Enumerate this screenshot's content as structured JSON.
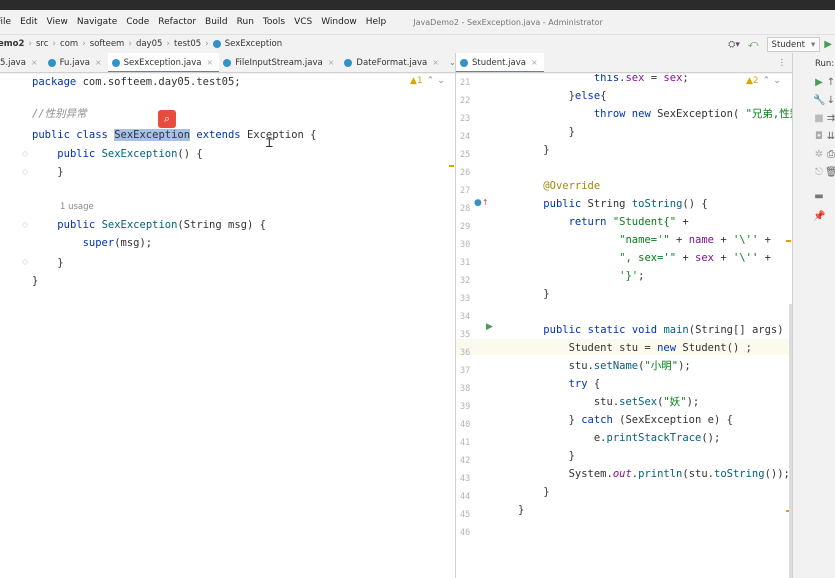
{
  "menu": {
    "items": [
      "File",
      "Edit",
      "View",
      "Navigate",
      "Code",
      "Refactor",
      "Build",
      "Run",
      "Tools",
      "VCS",
      "Window",
      "Help"
    ],
    "window_title": "JavaDemo2 - SexException.java - Administrator"
  },
  "breadcrumb": [
    "emo2",
    "src",
    "com",
    "softeem",
    "day05",
    "test05",
    "SexException"
  ],
  "run_config": "Student",
  "run_panel_label": "Run:",
  "left_tabs": [
    {
      "label": "5.java",
      "active": false
    },
    {
      "label": "Fu.java",
      "active": false
    },
    {
      "label": "SexException.java",
      "active": true
    },
    {
      "label": "FileInputStream.java",
      "active": false
    },
    {
      "label": "DateFormat.java",
      "active": false
    }
  ],
  "right_tabs": [
    {
      "label": "Student.java",
      "active": true
    }
  ],
  "left_editor": {
    "warning_count": "1",
    "usage_hint": "1 usage",
    "lines": [
      "package com.softeem.day05.test05;",
      "",
      "//性别异常",
      "public class SexException extends Exception {",
      "    public SexException() {",
      "    }",
      "",
      "    public SexException(String msg) {",
      "        super(msg);",
      "    }",
      "}"
    ]
  },
  "right_editor": {
    "warning_count": "2",
    "line_numbers": [
      "21",
      "22",
      "23",
      "24",
      "25",
      "26",
      "27",
      "28",
      "29",
      "30",
      "31",
      "32",
      "33",
      "34",
      "35",
      "36",
      "37",
      "38",
      "39",
      "40",
      "41",
      "42",
      "43",
      "44",
      "45",
      "46"
    ],
    "lines": [
      "            this.sex = sex;",
      "        }else{",
      "            throw new SexException( \"兄弟,性别",
      "        }",
      "    }",
      "",
      "    @Override",
      "    public String toString() {",
      "        return \"Student{\" +",
      "                \"name='\" + name + '\\'' +",
      "                \", sex='\" + sex + '\\'' +",
      "                '}';",
      "    }",
      "",
      "    public static void main(String[] args)",
      "        Student stu = new Student() ;",
      "        stu.setName(\"小明\");",
      "        try {",
      "            stu.setSex(\"妖\");",
      "        } catch (SexException e) {",
      "            e.printStackTrace();",
      "        }",
      "        System.out.println(stu.toString());",
      "    }",
      "}",
      ""
    ]
  },
  "icons": [
    "search-icon",
    "run-icon",
    "override-icon",
    "build-icon",
    "back-icon",
    "wrench-icon"
  ],
  "colors": {
    "accent": "#4a88c7",
    "selection": "#a6c1e8",
    "keyword": "#0033b3",
    "string": "#067d17",
    "search_badge": "#e74c3c"
  }
}
